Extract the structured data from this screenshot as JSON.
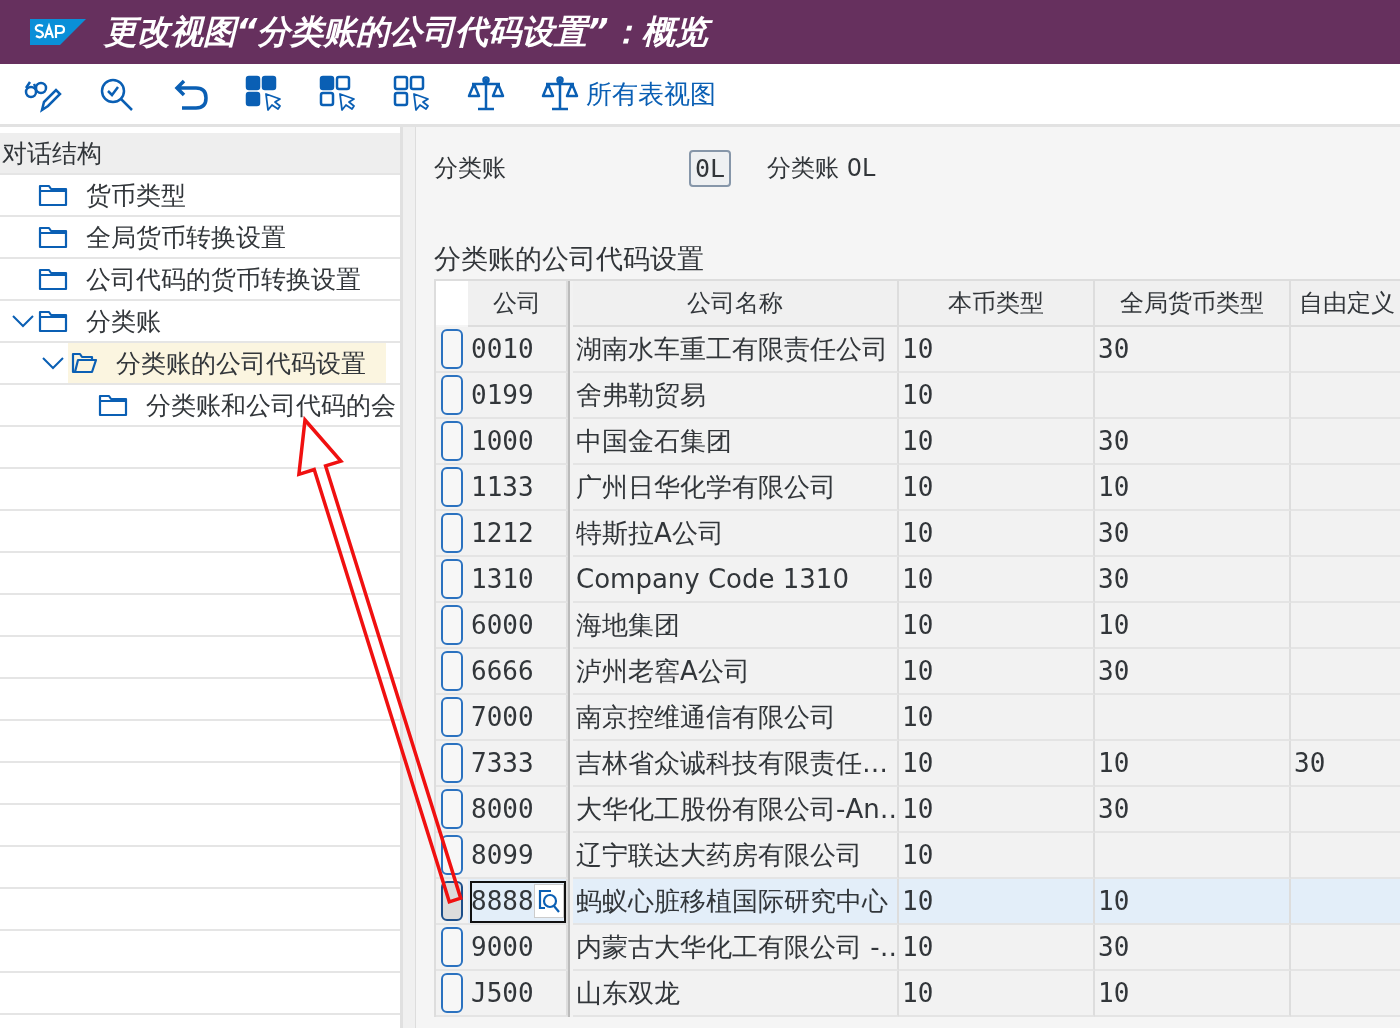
{
  "window": {
    "title": "更改视图“分类账的公司代码设置”：概览"
  },
  "toolbar": {
    "all_views_label": "所有表视图"
  },
  "tree": {
    "title": "对话结构",
    "items": [
      {
        "label": "货币类型",
        "expanded": false,
        "selected": false
      },
      {
        "label": "全局货币转换设置",
        "expanded": false,
        "selected": false
      },
      {
        "label": "公司代码的货币转换设置",
        "expanded": false,
        "selected": false
      },
      {
        "label": "分类账",
        "expanded": true,
        "selected": false,
        "children": [
          {
            "label": "分类账的公司代码设置",
            "expanded": true,
            "selected": true,
            "children": [
              {
                "label": "分类账和公司代码的会",
                "expanded": false,
                "selected": false
              }
            ]
          }
        ]
      }
    ]
  },
  "ledger_field": {
    "label": "分类账",
    "value": "0L",
    "description": "分类账 0L"
  },
  "table": {
    "title": "分类账的公司代码设置",
    "columns": [
      "公司",
      "公司名称",
      "本币类型",
      "全局货币类型",
      "自由定义"
    ],
    "rows": [
      {
        "cells": [
          "0010",
          "湖南水车重工有限责任公司",
          "10",
          "30",
          ""
        ],
        "selected": false
      },
      {
        "cells": [
          "0199",
          "舍弗勒贸易",
          "10",
          "",
          ""
        ],
        "selected": false
      },
      {
        "cells": [
          "1000",
          "中国金石集团",
          "10",
          "30",
          ""
        ],
        "selected": false
      },
      {
        "cells": [
          "1133",
          "广州日华化学有限公司",
          "10",
          "10",
          ""
        ],
        "selected": false
      },
      {
        "cells": [
          "1212",
          "特斯拉A公司",
          "10",
          "30",
          ""
        ],
        "selected": false
      },
      {
        "cells": [
          "1310",
          "Company Code 1310",
          "10",
          "30",
          ""
        ],
        "selected": false
      },
      {
        "cells": [
          "6000",
          "海地集团",
          "10",
          "10",
          ""
        ],
        "selected": false
      },
      {
        "cells": [
          "6666",
          "泸州老窖A公司",
          "10",
          "30",
          ""
        ],
        "selected": false
      },
      {
        "cells": [
          "7000",
          "南京控维通信有限公司",
          "10",
          "",
          ""
        ],
        "selected": false
      },
      {
        "cells": [
          "7333",
          "吉林省众诚科技有限责任…",
          "10",
          "10",
          "30"
        ],
        "selected": false
      },
      {
        "cells": [
          "8000",
          "大华化工股份有限公司-An…",
          "10",
          "30",
          ""
        ],
        "selected": false
      },
      {
        "cells": [
          "8099",
          "辽宁联达大药房有限公司",
          "10",
          "",
          ""
        ],
        "selected": false
      },
      {
        "cells": [
          "8888",
          "蚂蚁心脏移植国际研究中心",
          "10",
          "10",
          ""
        ],
        "selected": true
      },
      {
        "cells": [
          "9000",
          "内蒙古大华化工有限公司 -…",
          "10",
          "30",
          ""
        ],
        "selected": false
      },
      {
        "cells": [
          "J500",
          "山东双龙",
          "10",
          "10",
          ""
        ],
        "selected": false
      }
    ]
  }
}
